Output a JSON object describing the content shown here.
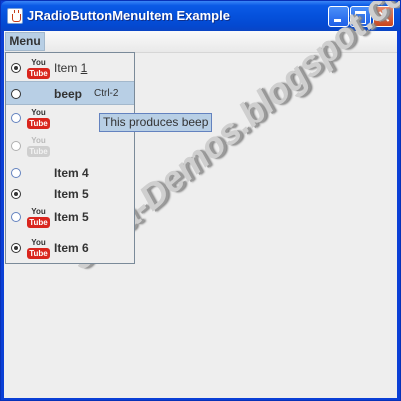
{
  "window": {
    "title": "JRadioButtonMenuItem Example"
  },
  "menubar": {
    "menu_label": "Menu"
  },
  "watermark": "Java-Demos.blogspot.com",
  "youtube_icon": {
    "top_text": "You",
    "bottom_text": "Tube"
  },
  "menu_items": [
    {
      "label_prefix": "Item ",
      "mnemonic": "1",
      "checked": true,
      "icon": "youtube-icon",
      "enabled": true
    },
    {
      "label": "beep",
      "accelerator": "Ctrl-2",
      "checked": false,
      "selected": true
    },
    {
      "label": "",
      "checked": false,
      "icon": "youtube-icon",
      "enabled": true
    },
    {
      "label": "",
      "checked": false,
      "icon": "youtube-icon",
      "enabled": false
    },
    {
      "label": "Item 4",
      "checked": false
    },
    {
      "label": "Item 5",
      "checked": true
    },
    {
      "label": "Item 5",
      "checked": false,
      "icon": "youtube-icon"
    },
    {
      "label": "Item 6",
      "checked": true,
      "icon": "youtube-icon"
    }
  ],
  "tooltip": {
    "text": "This produces beep"
  },
  "colors": {
    "title_bar": "#0551dc",
    "selection": "#b8cfe5",
    "youtube_red": "#d9251d"
  }
}
